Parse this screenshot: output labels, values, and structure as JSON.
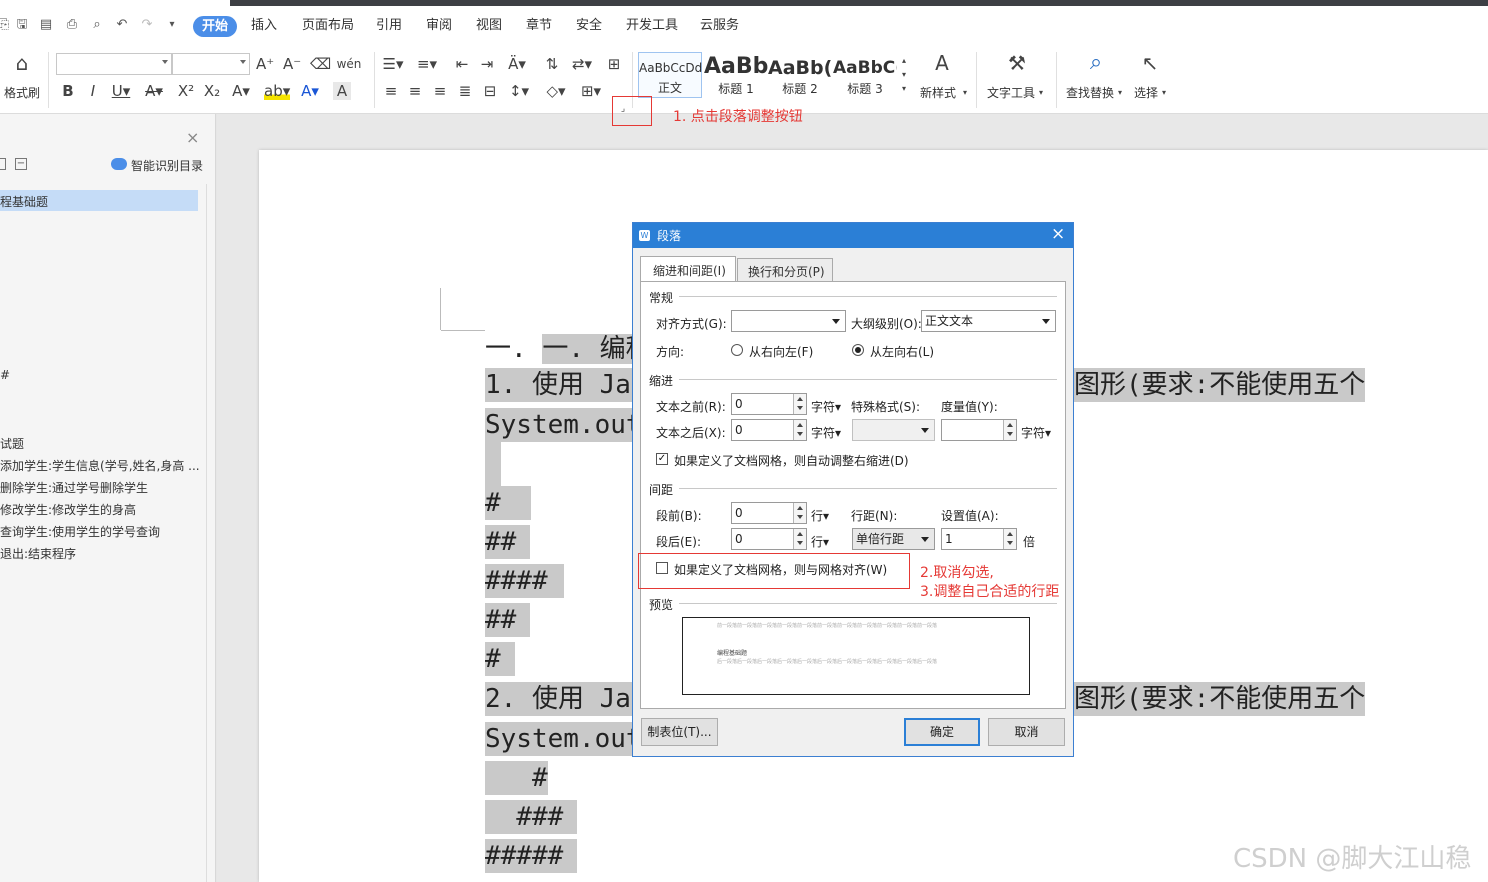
{
  "menu": {
    "tabs": [
      "开始",
      "插入",
      "页面布局",
      "引用",
      "审阅",
      "视图",
      "章节",
      "安全",
      "开发工具",
      "云服务"
    ]
  },
  "ribbon": {
    "format_painter": "格式刷",
    "styles": [
      {
        "preview": "AaBbCcDd",
        "label": "正文"
      },
      {
        "preview": "AaBb",
        "label": "标题 1"
      },
      {
        "preview": "AaBb(",
        "label": "标题 2"
      },
      {
        "preview": "AaBbC(",
        "label": "标题 3"
      }
    ],
    "new_style": "新样式",
    "text_tools": "文字工具",
    "find_replace": "查找替换",
    "select": "选择"
  },
  "sidebar": {
    "smart_toc": "智能识别目录",
    "items": [
      "程基础题",
      "#",
      "试题",
      "添加学生:学生信息(学号,姓名,身高 ...",
      "删除学生:通过学号删除学生",
      "修改学生:修改学生的身高",
      "查询学生:使用学生的学号查询",
      "退出:结束程序"
    ]
  },
  "document": {
    "lines": [
      "一. 编程基础",
      "1.  使用 Jav",
      "System.out",
      "#",
      "##",
      "####",
      "##",
      "#",
      "2.  使用 Jav",
      "System.out",
      "   #",
      "  ###",
      "#####"
    ],
    "right_fragment_1": "图形(要求:不能使用五个",
    "right_fragment_2": "图形(要求:不能使用五个"
  },
  "dialog": {
    "title": "段落",
    "tab_indent": "缩进和间距(I)",
    "tab_linebreak": "换行和分页(P)",
    "section_general": "常规",
    "align_label": "对齐方式(G):",
    "align_value": "",
    "outline_label": "大纲级别(O):",
    "outline_value": "正文文本",
    "direction_label": "方向:",
    "rtl": "从右向左(F)",
    "ltr": "从左向右(L)",
    "section_indent": "缩进",
    "before_text_label": "文本之前(R):",
    "before_text_value": "0",
    "after_text_label": "文本之后(X):",
    "after_text_value": "0",
    "unit_char": "字符",
    "special_label": "特殊格式(S):",
    "measure_label": "度量值(Y):",
    "auto_indent_check": "如果定义了文档网格，则自动调整右缩进(D)",
    "section_spacing": "间距",
    "before_label": "段前(B):",
    "before_value": "0",
    "after_label": "段后(E):",
    "after_value": "0",
    "unit_line": "行",
    "linespacing_label": "行距(N):",
    "linespacing_value": "单倍行距",
    "setvalue_label": "设置值(A):",
    "setvalue_value": "1",
    "unit_times": "倍",
    "grid_check": "如果定义了文档网格，则与网格对齐(W)",
    "section_preview": "预览",
    "preview_sample": "编程基础题",
    "preview_prev": "前一段落前一段落前一段落前一段落前一段落前一段落前一段落前一段落前一段落前一段落前一段落",
    "preview_next": "后一段落后一段落后一段落后一段落后一段落后一段落后一段落后一段落后一段落后一段落后一段落",
    "tabs_button": "制表位(T)...",
    "ok": "确定",
    "cancel": "取消"
  },
  "annotations": {
    "step1": "1. 点击段落调整按钮",
    "step2": "2.取消勾选,",
    "step3": "3.调整自己合适的行距"
  },
  "watermark": "CSDN @脚大江山稳",
  "colors": {
    "accent": "#2b7fd6",
    "annotation": "#e53935",
    "highlight": "#c9c9c9"
  }
}
